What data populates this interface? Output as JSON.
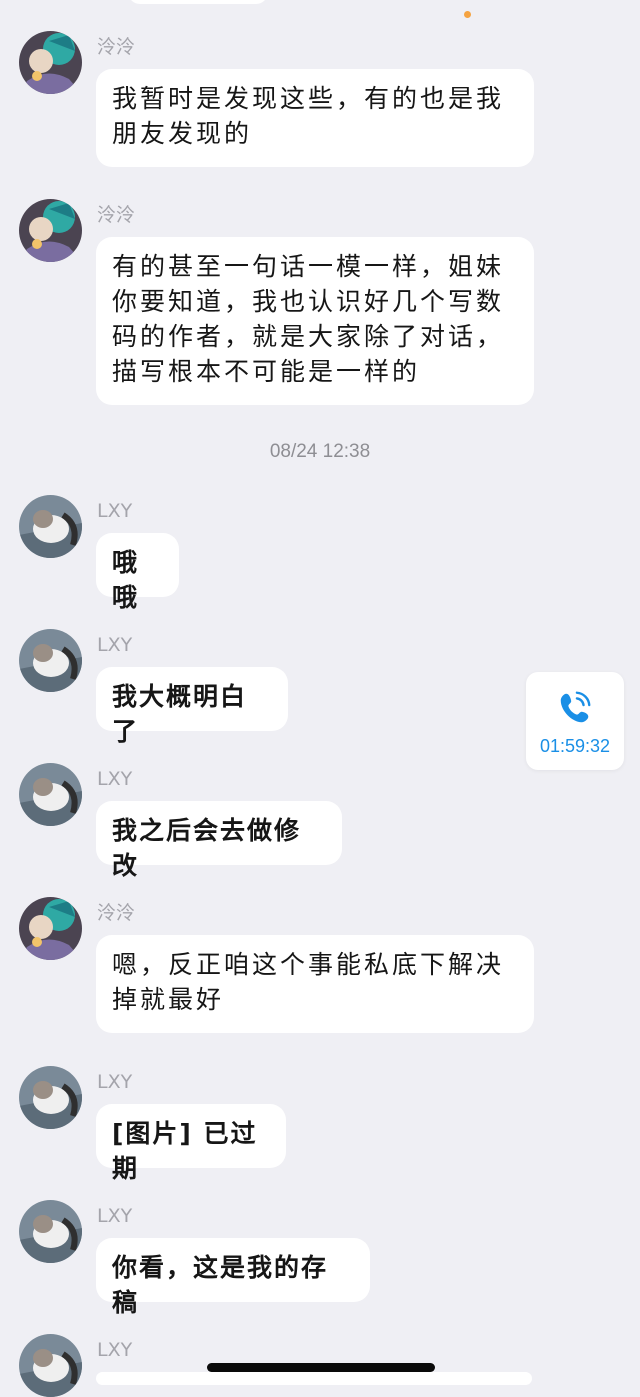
{
  "messages": [
    {
      "sender": "泠泠",
      "text": "我暂时是发现这些，有的也是我朋友发现的"
    },
    {
      "sender": "泠泠",
      "text": "有的甚至一句话一模一样，姐妹你要知道，我也认识好几个写数码的作者，就是大家除了对话，描写根本不可能是一样的"
    },
    {
      "sender": "LXY",
      "text": "哦哦"
    },
    {
      "sender": "LXY",
      "text": "我大概明白了"
    },
    {
      "sender": "LXY",
      "text": "我之后会去做修改"
    },
    {
      "sender": "泠泠",
      "text": "嗯，反正咱这个事能私底下解决掉就最好"
    },
    {
      "sender": "LXY",
      "text": "[图片] 已过期"
    },
    {
      "sender": "LXY",
      "text": "你看，这是我的存稿"
    },
    {
      "sender": "LXY",
      "text": ""
    }
  ],
  "timestamp": "08/24 12:38",
  "call": {
    "duration": "01:59:32",
    "icon": "phone-icon"
  },
  "colors": {
    "background": "#efeff4",
    "bubble": "#ffffff",
    "sender": "#a4a4ab",
    "call_accent": "#1a8fe6",
    "unread_dot": "#f5a341"
  }
}
